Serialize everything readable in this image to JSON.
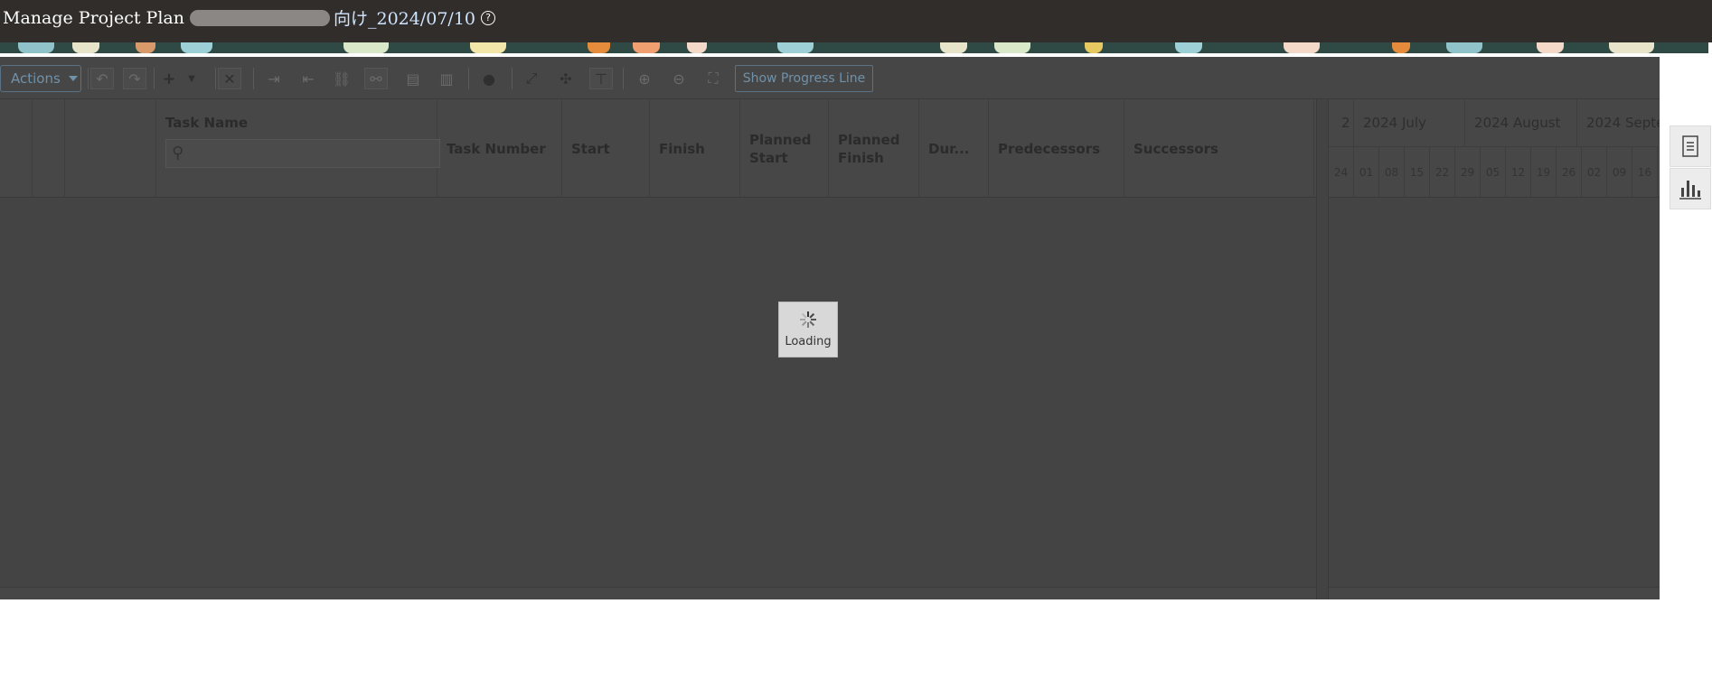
{
  "header": {
    "title": "Manage Project Plan",
    "title_suffix": "向け_2024/07/10",
    "help_icon": "question-circle-icon"
  },
  "toolbar": {
    "actions_label": "Actions",
    "show_progress_line_label": "Show Progress Line",
    "icons": [
      "undo-icon",
      "redo-icon",
      "add-icon",
      "add-dropdown-icon",
      "delete-icon",
      "indent-icon",
      "outdent-icon",
      "link-icon",
      "unlink-icon",
      "table-icon",
      "resources-icon",
      "lightbulb-icon",
      "expand-icon",
      "collapse-icon",
      "column-icon",
      "zoom-in-icon",
      "zoom-out-icon",
      "fit-icon"
    ]
  },
  "grid": {
    "columns": {
      "task_name": "Task Name",
      "task_number": "Task Number",
      "start": "Start",
      "finish": "Finish",
      "planned_start_1": "Planned",
      "planned_start_2": "Start",
      "planned_finish_1": "Planned",
      "planned_finish_2": "Finish",
      "duration": "Dur...",
      "predecessors": "Predecessors",
      "successors": "Successors"
    },
    "search_placeholder": ""
  },
  "gantt": {
    "months": [
      "2",
      "2024 July",
      "2024 August",
      "2024 Septe"
    ],
    "weeks": [
      "24",
      "01",
      "08",
      "15",
      "22",
      "29",
      "05",
      "12",
      "19",
      "26",
      "02",
      "09",
      "16"
    ]
  },
  "loading": {
    "label": "Loading"
  },
  "side_panel": {
    "icons": [
      "document-icon",
      "bar-chart-icon"
    ]
  }
}
